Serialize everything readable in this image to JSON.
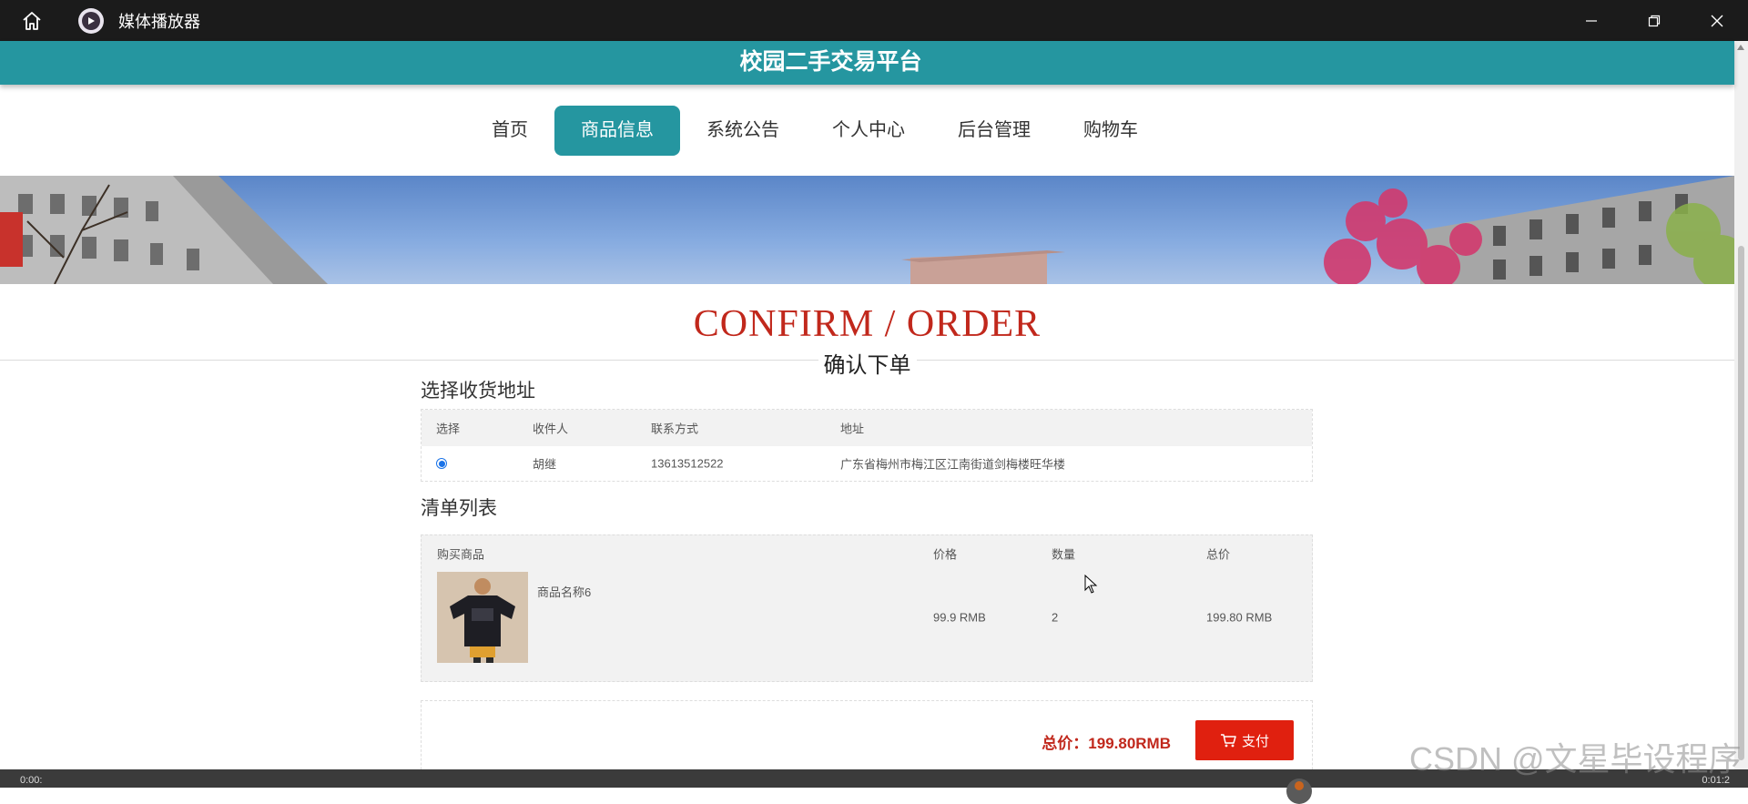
{
  "window": {
    "title": "媒体播放器"
  },
  "site": {
    "title": "校园二手交易平台"
  },
  "nav": {
    "items": [
      "首页",
      "商品信息",
      "系统公告",
      "个人中心",
      "后台管理",
      "购物车"
    ],
    "active": "商品信息"
  },
  "page": {
    "title_en": "CONFIRM / ORDER",
    "title_cn": "确认下单"
  },
  "address": {
    "section_title": "选择收货地址",
    "headers": [
      "选择",
      "收件人",
      "联系方式",
      "地址"
    ],
    "rows": [
      {
        "selected": true,
        "name": "胡继",
        "phone": "13613512522",
        "address": "广东省梅州市梅江区江南街道剑梅楼旺华楼"
      }
    ]
  },
  "cart": {
    "section_title": "清单列表",
    "headers": [
      "购买商品",
      "价格",
      "数量",
      "总价"
    ],
    "items": [
      {
        "name": "商品名称6",
        "price": "99.9 RMB",
        "quantity": "2",
        "total": "199.80 RMB"
      }
    ]
  },
  "checkout": {
    "total_text": "总价：199.80RMB",
    "pay_label": "支付"
  },
  "player": {
    "elapsed": "0:00:",
    "remaining": "0:01:2"
  },
  "watermark": "CSDN @文星毕设程序",
  "colors": {
    "brand": "#2596a0",
    "accent_red": "#c1281c",
    "pay_button": "#e0200f"
  }
}
